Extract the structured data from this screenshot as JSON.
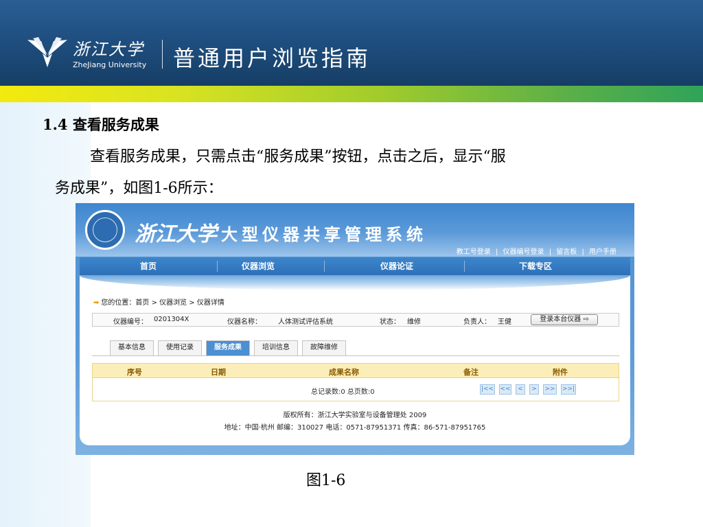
{
  "slide_header": {
    "university_cn": "浙江大学",
    "university_en": "ZheJiang University",
    "title": "普通用户浏览指南"
  },
  "section": {
    "title": "1.4 查看服务成果",
    "paragraph_line1": "查看服务成果，只需点击“服务成果”按钮，点击之后，显示“服",
    "paragraph_line2": "务成果”，如图1-6所示：",
    "caption": "图1-6"
  },
  "screenshot": {
    "banner_university": "浙江大学",
    "banner_title": "大型仪器共享管理系统",
    "top_links": [
      "教工号登录",
      "|",
      "仪器编号登录",
      "|",
      "留言板",
      "|",
      "用户手册"
    ],
    "nav": [
      "首页",
      "仪器浏览",
      "仪器论证",
      "下载专区"
    ],
    "breadcrumb": "您的位置：首页 > 仪器浏览 > 仪器详情",
    "info": {
      "code_label": "仪器编号：",
      "code_value": "0201304X",
      "name_label": "仪器名称：",
      "name_value": "人体测试评估系统",
      "status_label": "状态：",
      "status_value": "维修",
      "owner_label": "负责人：",
      "owner_value": "王健",
      "login_button": "登录本台仪器"
    },
    "tabs": [
      "基本信息",
      "使用记录",
      "服务成果",
      "培训信息",
      "故障维修"
    ],
    "active_tab": "服务成果",
    "table_headers": [
      "序号",
      "日期",
      "成果名称",
      "备注",
      "附件"
    ],
    "record_count": "总记录数:0  总页数:0",
    "pager": [
      "|<<",
      "<<",
      "<",
      ">",
      ">>",
      ">>|"
    ],
    "footer_line1": "版权所有：浙江大学实验室与设备管理处  2009",
    "footer_line2": "地址：中国·杭州  邮编：310027  电话：0571-87951371  传真：86-571-87951765"
  },
  "colors": {
    "header_blue": "#1f4f80",
    "stripe_yellow": "#f3ea0e",
    "stripe_green": "#2fa35a",
    "active_tab": "#4c8fd2",
    "table_header_bg": "#fbeeb8"
  }
}
